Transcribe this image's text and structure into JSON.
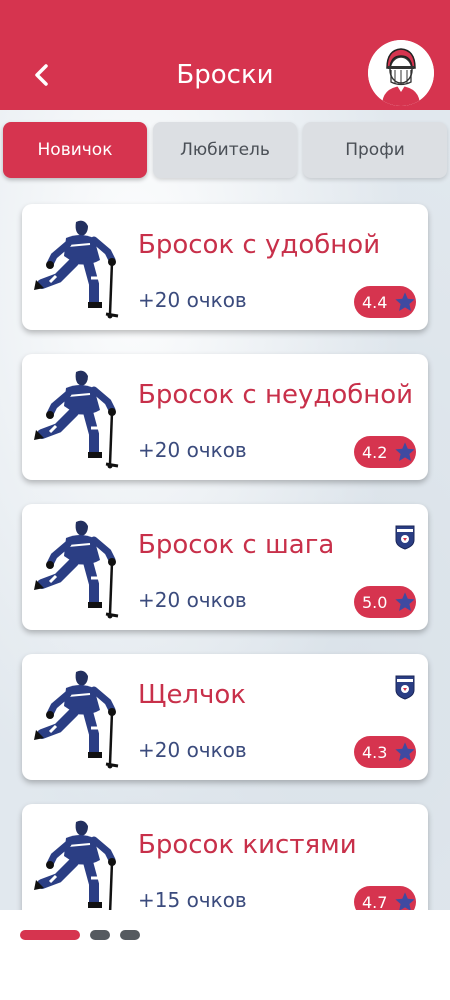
{
  "header": {
    "title": "Броски"
  },
  "tabs": [
    {
      "label": "Новичок",
      "active": true
    },
    {
      "label": "Любитель",
      "active": false
    },
    {
      "label": "Профи",
      "active": false
    }
  ],
  "colors": {
    "accent": "#d6344f",
    "title_text": "#c8304a",
    "points_text": "#3b4b7d",
    "star": "#3f4aa1",
    "dot_inactive": "#555a5f"
  },
  "cards": [
    {
      "title": "Бросок с удобной",
      "points": "+20 очков",
      "rating": "4.4",
      "badge": false
    },
    {
      "title": "Бросок с неудобной",
      "points": "+20 очков",
      "rating": "4.2",
      "badge": false
    },
    {
      "title": "Бросок с шага",
      "points": "+20 очков",
      "rating": "5.0",
      "badge": true
    },
    {
      "title": "Щелчок",
      "points": "+20 очков",
      "rating": "4.3",
      "badge": true
    },
    {
      "title": "Бросок кистями",
      "points": "+15 очков",
      "rating": "4.7",
      "badge": false
    }
  ],
  "pager": {
    "pages": 3,
    "current": 1
  }
}
